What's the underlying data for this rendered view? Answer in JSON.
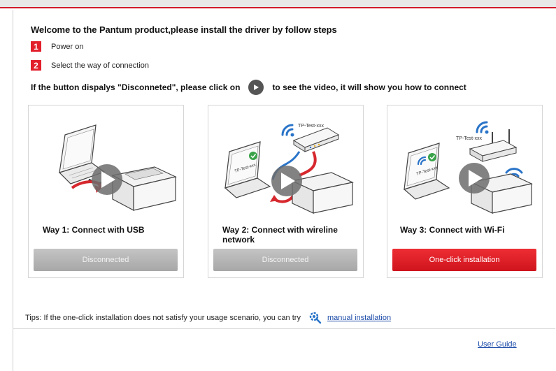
{
  "header": {
    "title": "Welcome to the Pantum product,please install the driver by follow steps"
  },
  "steps": [
    {
      "number": "1",
      "text": "Power on"
    },
    {
      "number": "2",
      "text": "Select the way of connection"
    }
  ],
  "notice": {
    "before": "If the button dispalys \"Disconneted\", please click on",
    "after": "to see the video, it will show you how to connect"
  },
  "ways": [
    {
      "label": "Way 1: Connect with USB",
      "button": "Disconnected",
      "status": "disconnected"
    },
    {
      "label": "Way 2: Connect with wireline network",
      "button": "Disconnected",
      "status": "disconnected",
      "router_label": "TP-Test-xxx",
      "laptop_label": "TP-Test-xxx"
    },
    {
      "label": "Way 3: Connect with Wi-Fi",
      "button": "One-click installation",
      "status": "active",
      "router_label": "TP-Test-xxx",
      "laptop_label": "TP-Test-xxx"
    }
  ],
  "tips": {
    "text": "Tips: If the one-click installation does not satisfy your usage scenario, you can try",
    "link": "manual installation"
  },
  "footer": {
    "user_guide": "User Guide"
  },
  "colors": {
    "accent_red": "#e21e2b",
    "disabled_gray": "#b5b5b5",
    "link_blue": "#1a4aa8",
    "wifi_blue": "#2a74c8"
  },
  "icons": [
    "play-icon",
    "gear-magnifier-icon",
    "wifi-icon",
    "check-icon"
  ]
}
